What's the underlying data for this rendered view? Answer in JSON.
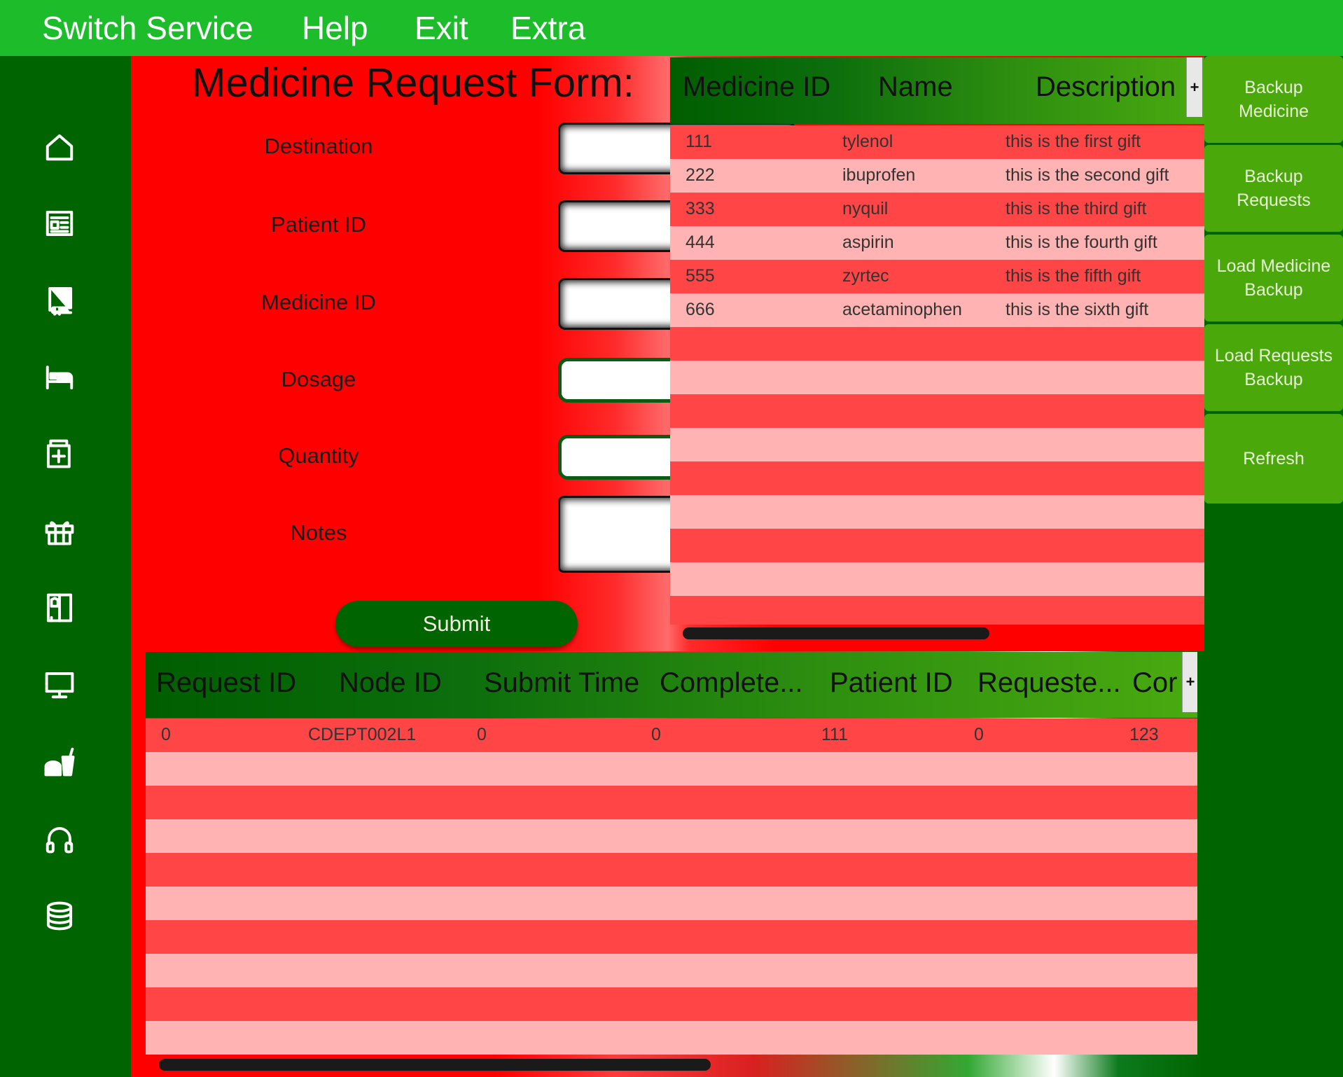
{
  "menu": [
    "Switch Service",
    "Help",
    "Exit",
    "Extra"
  ],
  "sidebar": {
    "icons": [
      "home-icon",
      "newspaper-icon",
      "book-icon",
      "bed-icon",
      "medicine-icon",
      "gift-icon",
      "wardrobe-icon",
      "monitor-icon",
      "fast-food-icon",
      "headset-icon",
      "database-icon"
    ]
  },
  "form": {
    "title": "Medicine Request Form:",
    "destination_label": "Destination",
    "patient_id_label": "Patient ID",
    "medicine_id_label": "Medicine ID",
    "dosage_label": "Dosage",
    "quantity_label": "Quantity",
    "notes_label": "Notes",
    "submit_label": "Submit",
    "destination_value": "",
    "patient_id_value": "",
    "medicine_id_value": "",
    "dosage_value": "",
    "quantity_value": "",
    "notes_value": ""
  },
  "medicine_table": {
    "headers": [
      "Medicine ID",
      "Name",
      "Description"
    ],
    "rows": [
      [
        "111",
        "tylenol",
        "this is the first gift"
      ],
      [
        "222",
        "ibuprofen",
        "this is the second gift"
      ],
      [
        "333",
        "nyquil",
        "this is the third gift"
      ],
      [
        "444",
        "aspirin",
        "this is the fourth gift"
      ],
      [
        "555",
        "zyrtec",
        "this is the fifth gift"
      ],
      [
        "666",
        "acetaminophen",
        "this is the sixth gift"
      ]
    ],
    "plus": "+"
  },
  "request_table": {
    "headers": [
      "Request ID",
      "Node ID",
      "Submit Time",
      "Complete...",
      "Patient ID",
      "Requeste...",
      "Cor"
    ],
    "rows": [
      [
        "0",
        "CDEPT002L1",
        "0",
        "0",
        "111",
        "0",
        "123"
      ]
    ],
    "plus": "+"
  },
  "right_buttons": [
    "Backup\nMedicine",
    "Backup\nRequests",
    "Load Medicine\nBackup",
    "Load Requests\nBackup",
    "Refresh"
  ],
  "colors": {
    "menu_bar": "#1cbc2a",
    "sidebar": "#006400",
    "form_background": "#ff0000",
    "row_odd": "#ff4545",
    "row_even": "#ffb3b3",
    "right_button": "#4aa80a",
    "submit_button": "#006400"
  }
}
